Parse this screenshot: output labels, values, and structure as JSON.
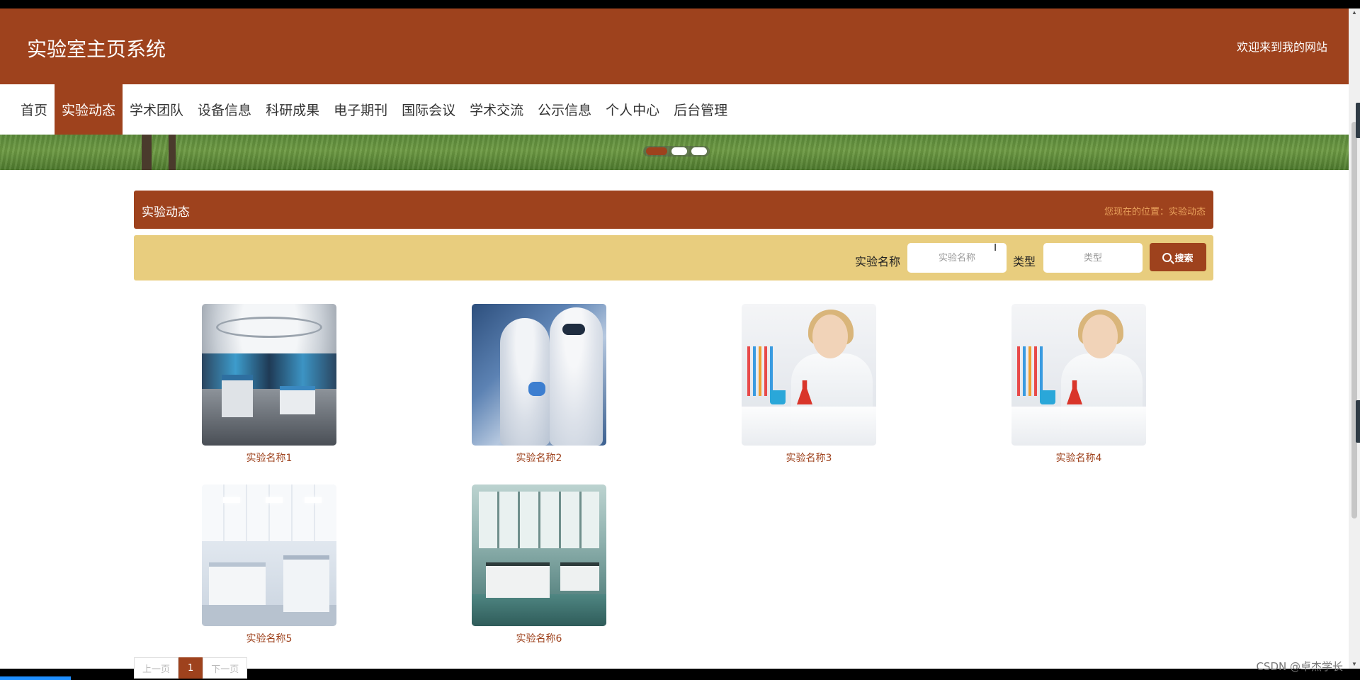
{
  "header": {
    "title": "实验室主页系统",
    "welcome": "欢迎来到我的网站"
  },
  "nav": {
    "items": [
      {
        "label": "首页"
      },
      {
        "label": "实验动态",
        "active": true
      },
      {
        "label": "学术团队"
      },
      {
        "label": "设备信息"
      },
      {
        "label": "科研成果"
      },
      {
        "label": "电子期刊"
      },
      {
        "label": "国际会议"
      },
      {
        "label": "学术交流"
      },
      {
        "label": "公示信息"
      },
      {
        "label": "个人中心"
      },
      {
        "label": "后台管理"
      }
    ]
  },
  "banner": {
    "slide_count": 3,
    "active_slide": 1
  },
  "section": {
    "title": "实验动态",
    "breadcrumb": "您现在的位置：实验动态"
  },
  "search": {
    "name_label": "实验名称",
    "name_placeholder": "实验名称",
    "type_label": "类型",
    "type_placeholder": "类型",
    "button_label": "搜索"
  },
  "items": [
    {
      "name": "实验名称1"
    },
    {
      "name": "实验名称2"
    },
    {
      "name": "实验名称3"
    },
    {
      "name": "实验名称4"
    },
    {
      "name": "实验名称5"
    },
    {
      "name": "实验名称6"
    }
  ],
  "pagination": {
    "prev": "上一页",
    "current": "1",
    "next": "下一页"
  },
  "watermark": "CSDN @卓杰学长",
  "colors": {
    "primary": "#9e421d",
    "search_bar": "#e8cd7e",
    "breadcrumb": "#e8a05b"
  }
}
